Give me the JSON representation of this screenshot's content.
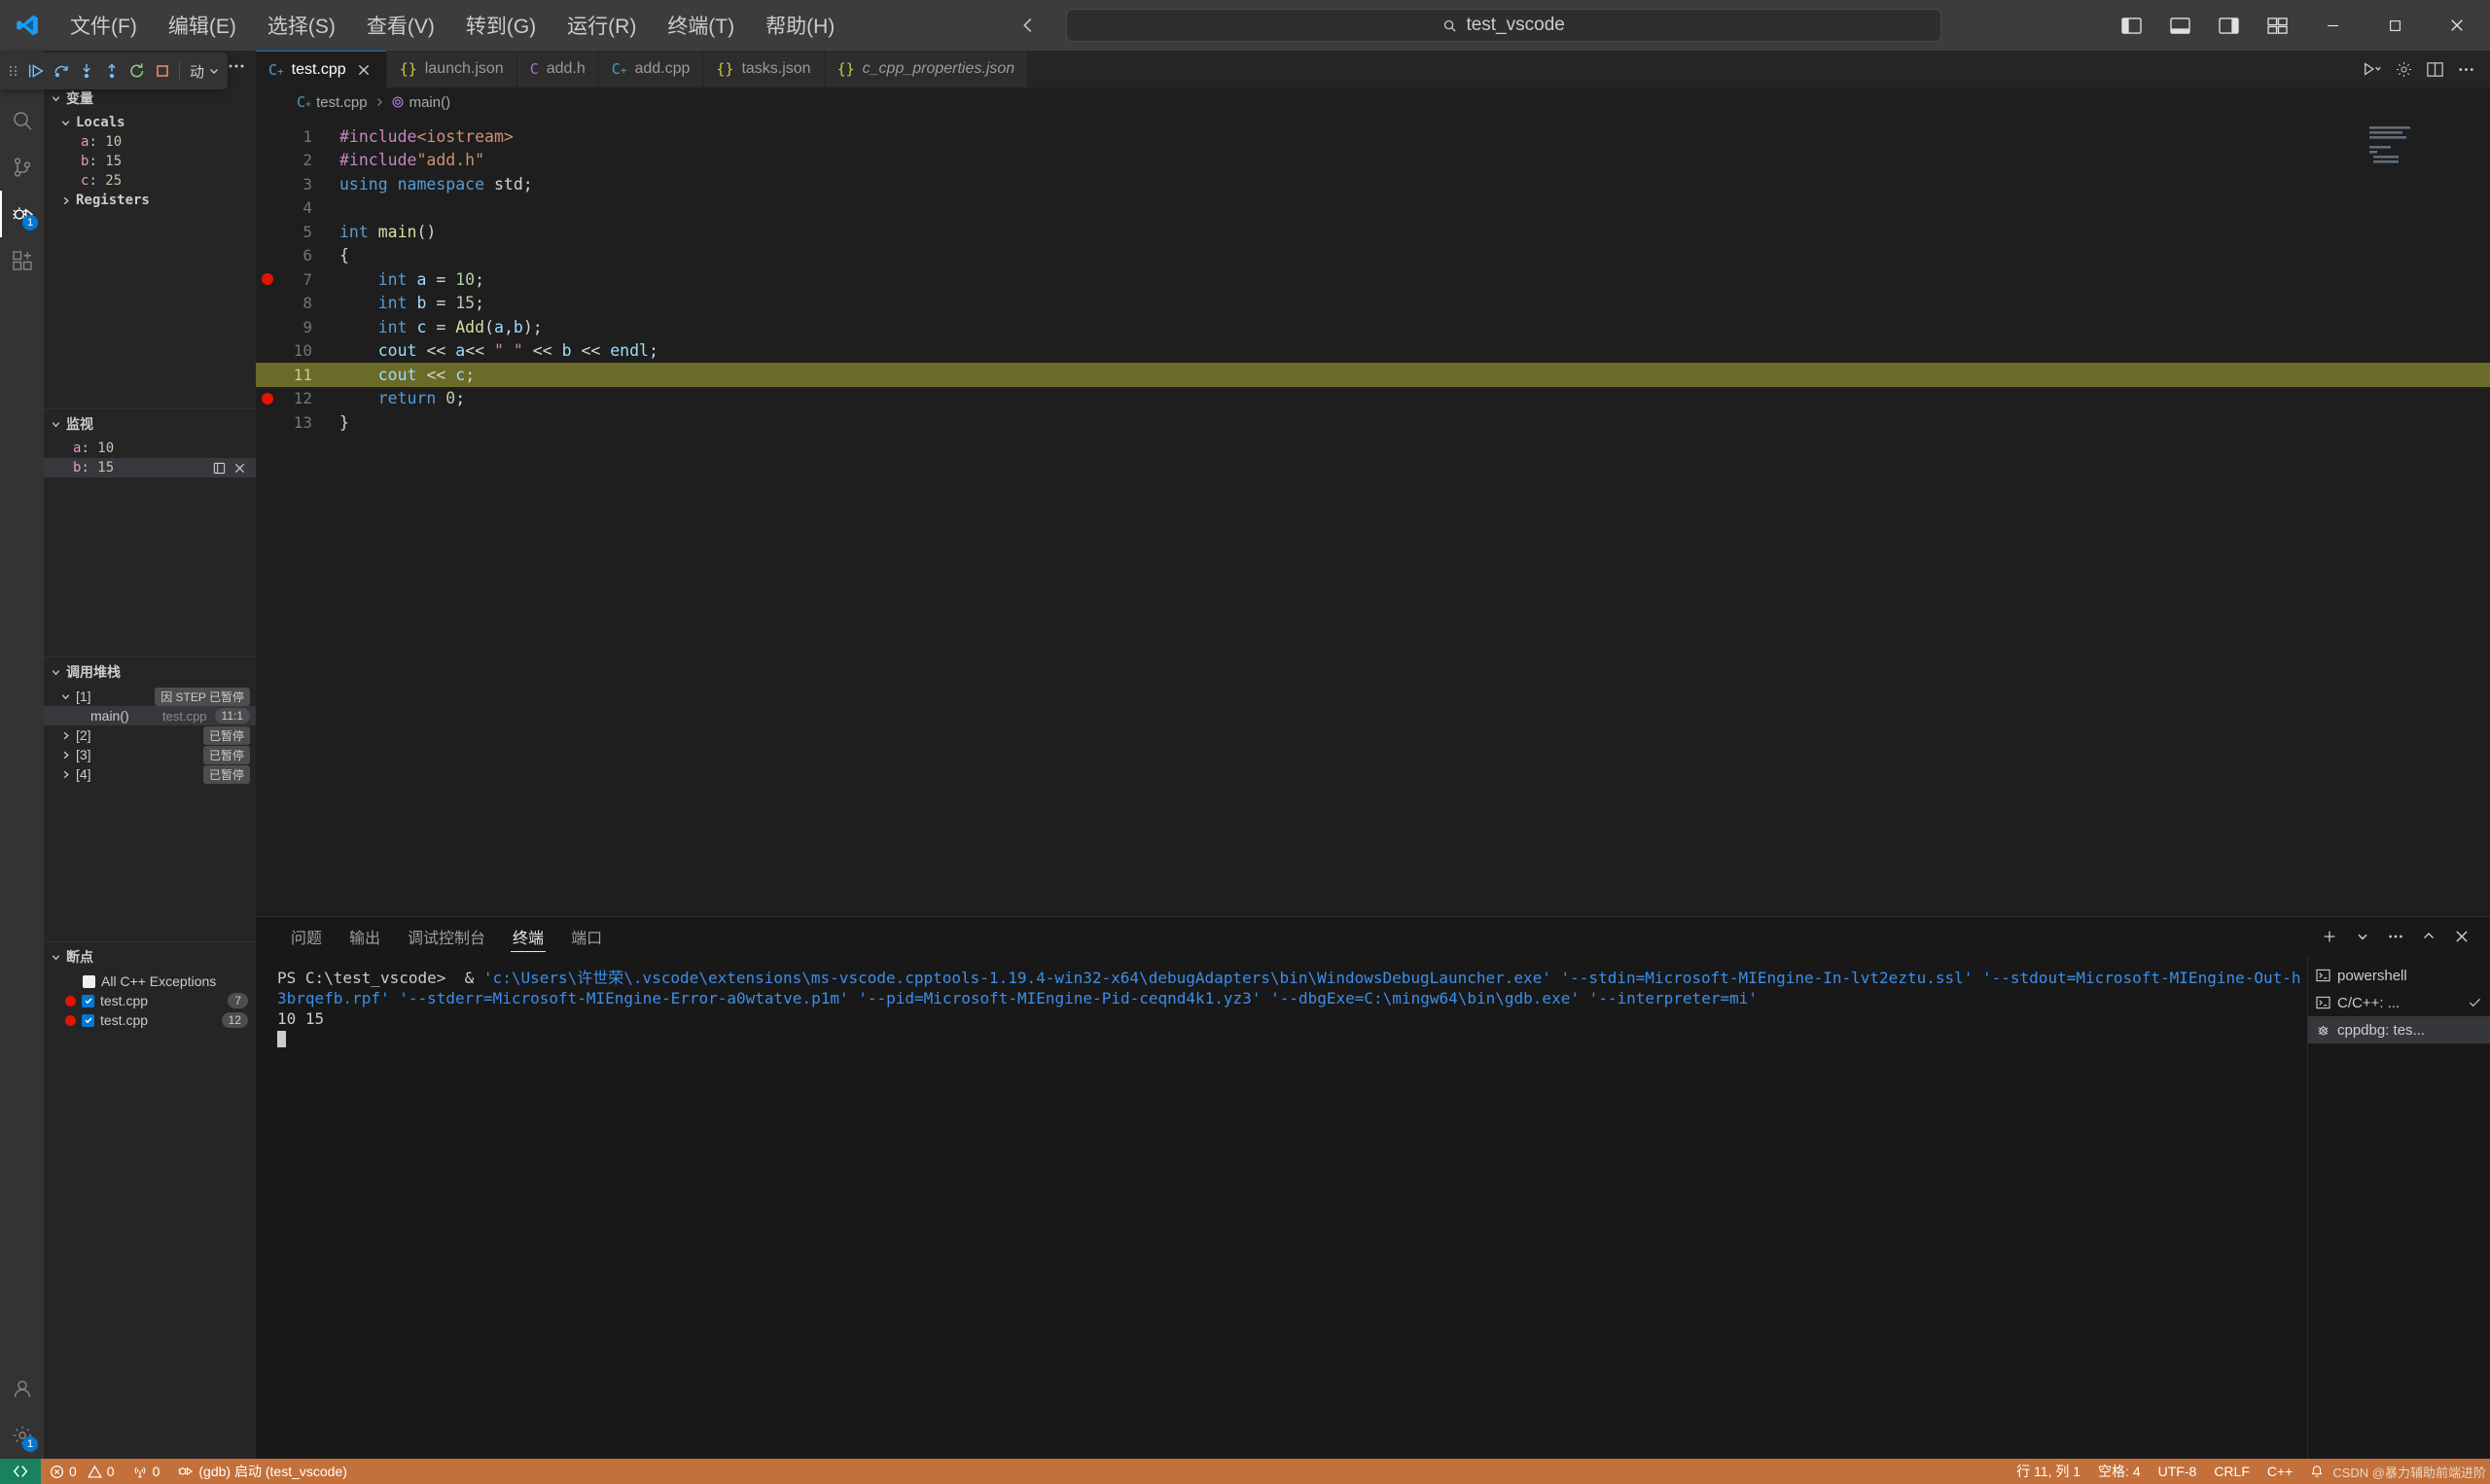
{
  "titlebar": {
    "menu": [
      "文件(F)",
      "编辑(E)",
      "选择(S)",
      "查看(V)",
      "转到(G)",
      "运行(R)",
      "终端(T)",
      "帮助(H)"
    ],
    "command_center_text": "test_vscode",
    "search_icon": "search-icon",
    "layout_icons": [
      "toggle-primary-sidebar-icon",
      "toggle-panel-icon",
      "toggle-secondary-sidebar-icon",
      "customize-layout-icon"
    ],
    "window_controls": [
      "minimize",
      "maximize",
      "close"
    ]
  },
  "debug_toolbar": {
    "buttons": [
      {
        "name": "continue",
        "icon": "continue-icon"
      },
      {
        "name": "step-over",
        "icon": "step-over-icon"
      },
      {
        "name": "step-into",
        "icon": "step-into-icon"
      },
      {
        "name": "step-out",
        "icon": "step-out-icon"
      },
      {
        "name": "restart",
        "icon": "restart-icon"
      },
      {
        "name": "stop",
        "icon": "stop-icon"
      }
    ],
    "session_label": "动",
    "gear_icon": "gear-icon",
    "more_icon": "more-icon"
  },
  "activitybar": {
    "items": [
      {
        "name": "explorer",
        "icon": "files-icon",
        "active": false,
        "badge": ""
      },
      {
        "name": "search",
        "icon": "search-icon",
        "active": false,
        "badge": ""
      },
      {
        "name": "source-control",
        "icon": "source-control-icon",
        "active": false,
        "badge": ""
      },
      {
        "name": "run-and-debug",
        "icon": "debug-icon",
        "active": true,
        "badge": "1"
      },
      {
        "name": "extensions",
        "icon": "extensions-icon",
        "active": false,
        "badge": ""
      }
    ],
    "bottom": [
      {
        "name": "accounts",
        "icon": "account-icon",
        "badge": ""
      },
      {
        "name": "settings",
        "icon": "gear-icon",
        "badge": "1"
      }
    ]
  },
  "sidebar": {
    "variables": {
      "title": "变量",
      "groups": [
        {
          "label": "Locals",
          "expanded": true,
          "items": [
            {
              "name": "a",
              "value": "10"
            },
            {
              "name": "b",
              "value": "15"
            },
            {
              "name": "c",
              "value": "25"
            }
          ]
        },
        {
          "label": "Registers",
          "expanded": false,
          "items": []
        }
      ]
    },
    "watch": {
      "title": "监视",
      "items": [
        {
          "name": "a",
          "value": "10",
          "selected": false
        },
        {
          "name": "b",
          "value": "15",
          "selected": true
        }
      ],
      "row_icons": [
        "edit-icon",
        "remove-icon"
      ]
    },
    "callstack": {
      "title": "调用堆栈",
      "threads": [
        {
          "label": "[1]",
          "expanded": true,
          "status": "因 STEP 已暂停",
          "frames": [
            {
              "label": "main()",
              "file": "test.cpp",
              "line": "11:1",
              "selected": true
            }
          ]
        },
        {
          "label": "[2]",
          "expanded": false,
          "status": "已暂停",
          "frames": []
        },
        {
          "label": "[3]",
          "expanded": false,
          "status": "已暂停",
          "frames": []
        },
        {
          "label": "[4]",
          "expanded": false,
          "status": "已暂停",
          "frames": []
        }
      ]
    },
    "breakpoints": {
      "title": "断点",
      "items": [
        {
          "label": "All C++ Exceptions",
          "checked": false,
          "has_dot": false,
          "line": ""
        },
        {
          "label": "test.cpp",
          "checked": true,
          "has_dot": true,
          "line": "7"
        },
        {
          "label": "test.cpp",
          "checked": true,
          "has_dot": true,
          "line": "12"
        }
      ]
    }
  },
  "editor": {
    "tabs": [
      {
        "label": "test.cpp",
        "icon": "cpp-file-icon",
        "icon_text": "C",
        "active": true,
        "closable": true
      },
      {
        "label": "launch.json",
        "icon": "json-file-icon",
        "icon_text": "{}",
        "active": false,
        "closable": false
      },
      {
        "label": "add.h",
        "icon": "c-header-icon",
        "icon_text": "C",
        "active": false,
        "closable": false
      },
      {
        "label": "add.cpp",
        "icon": "cpp-file-icon",
        "icon_text": "C",
        "active": false,
        "closable": false
      },
      {
        "label": "tasks.json",
        "icon": "json-file-icon",
        "icon_text": "{}",
        "active": false,
        "closable": false
      },
      {
        "label": "c_cpp_properties.json",
        "icon": "json-file-icon",
        "icon_text": "{}",
        "active": false,
        "closable": false,
        "italic": true
      }
    ],
    "tabbar_actions": [
      "run-or-debug-icon",
      "settings-icon",
      "split-editor-icon",
      "more-actions-icon"
    ],
    "breadcrumb": [
      "test.cpp",
      "main()"
    ],
    "lines": [
      {
        "n": "1",
        "bp": "none",
        "hl": false,
        "tokens": [
          {
            "t": "#include",
            "c": "t-pre"
          },
          {
            "t": "<iostream>",
            "c": "t-inc"
          }
        ]
      },
      {
        "n": "2",
        "bp": "none",
        "hl": false,
        "tokens": [
          {
            "t": "#include",
            "c": "t-pre"
          },
          {
            "t": "\"add.h\"",
            "c": "t-str"
          }
        ]
      },
      {
        "n": "3",
        "bp": "none",
        "hl": false,
        "tokens": [
          {
            "t": "using ",
            "c": "t-key"
          },
          {
            "t": "namespace ",
            "c": "t-key"
          },
          {
            "t": "std;",
            "c": "t-plain"
          }
        ]
      },
      {
        "n": "4",
        "bp": "none",
        "hl": false,
        "tokens": []
      },
      {
        "n": "5",
        "bp": "none",
        "hl": false,
        "tokens": [
          {
            "t": "int ",
            "c": "t-key"
          },
          {
            "t": "main",
            "c": "t-fn"
          },
          {
            "t": "()",
            "c": "t-plain"
          }
        ]
      },
      {
        "n": "6",
        "bp": "none",
        "hl": false,
        "tokens": [
          {
            "t": "{",
            "c": "t-plain"
          }
        ]
      },
      {
        "n": "7",
        "bp": "dot",
        "hl": false,
        "tokens": [
          {
            "t": "    ",
            "c": "t-plain"
          },
          {
            "t": "int ",
            "c": "t-key"
          },
          {
            "t": "a ",
            "c": "t-var"
          },
          {
            "t": "= ",
            "c": "t-op"
          },
          {
            "t": "10",
            "c": "t-num"
          },
          {
            "t": ";",
            "c": "t-plain"
          }
        ]
      },
      {
        "n": "8",
        "bp": "none",
        "hl": false,
        "tokens": [
          {
            "t": "    ",
            "c": "t-plain"
          },
          {
            "t": "int ",
            "c": "t-key"
          },
          {
            "t": "b ",
            "c": "t-var"
          },
          {
            "t": "= ",
            "c": "t-op"
          },
          {
            "t": "15",
            "c": "t-num"
          },
          {
            "t": ";",
            "c": "t-plain"
          }
        ]
      },
      {
        "n": "9",
        "bp": "none",
        "hl": false,
        "tokens": [
          {
            "t": "    ",
            "c": "t-plain"
          },
          {
            "t": "int ",
            "c": "t-key"
          },
          {
            "t": "c ",
            "c": "t-var"
          },
          {
            "t": "= ",
            "c": "t-op"
          },
          {
            "t": "Add",
            "c": "t-fn"
          },
          {
            "t": "(",
            "c": "t-plain"
          },
          {
            "t": "a",
            "c": "t-var"
          },
          {
            "t": ",",
            "c": "t-plain"
          },
          {
            "t": "b",
            "c": "t-var"
          },
          {
            "t": ");",
            "c": "t-plain"
          }
        ]
      },
      {
        "n": "10",
        "bp": "none",
        "hl": false,
        "tokens": [
          {
            "t": "    ",
            "c": "t-plain"
          },
          {
            "t": "cout ",
            "c": "t-var"
          },
          {
            "t": "<< ",
            "c": "t-op"
          },
          {
            "t": "a",
            "c": "t-var"
          },
          {
            "t": "<< ",
            "c": "t-op"
          },
          {
            "t": "\" \"",
            "c": "t-str"
          },
          {
            "t": " << ",
            "c": "t-op"
          },
          {
            "t": "b ",
            "c": "t-var"
          },
          {
            "t": "<< ",
            "c": "t-op"
          },
          {
            "t": "endl",
            "c": "t-var"
          },
          {
            "t": ";",
            "c": "t-plain"
          }
        ]
      },
      {
        "n": "11",
        "bp": "arrow",
        "hl": true,
        "tokens": [
          {
            "t": "    ",
            "c": "t-plain"
          },
          {
            "t": "cout ",
            "c": "t-var"
          },
          {
            "t": "<< ",
            "c": "t-op"
          },
          {
            "t": "c",
            "c": "t-var"
          },
          {
            "t": ";",
            "c": "t-plain"
          }
        ]
      },
      {
        "n": "12",
        "bp": "dot",
        "hl": false,
        "tokens": [
          {
            "t": "    ",
            "c": "t-plain"
          },
          {
            "t": "return ",
            "c": "t-key"
          },
          {
            "t": "0",
            "c": "t-num"
          },
          {
            "t": ";",
            "c": "t-plain"
          }
        ]
      },
      {
        "n": "13",
        "bp": "none",
        "hl": false,
        "tokens": [
          {
            "t": "}",
            "c": "t-plain"
          }
        ]
      }
    ]
  },
  "panel": {
    "tabs": [
      {
        "label": "问题",
        "active": false
      },
      {
        "label": "输出",
        "active": false
      },
      {
        "label": "调试控制台",
        "active": false
      },
      {
        "label": "终端",
        "active": true
      },
      {
        "label": "端口",
        "active": false
      }
    ],
    "actions": [
      "new-terminal-icon",
      "split-dropdown-icon",
      "more-actions-icon",
      "maximize-panel-icon",
      "close-panel-icon"
    ],
    "terminal_lines": [
      "PS C:\\test_vscode>  & 'c:\\Users\\许世荣\\.vscode\\extensions\\ms-vscode.cpptools-1.19.4-win32-x64\\debugAdapters\\bin\\WindowsDebugLauncher.exe' '--stdin=Microsoft-MIEngine-In-lvt2eztu.ssl' '--stdout=Microsoft-MIEngine-Out-h3brqefb.rpf' '--stderr=Microsoft-MIEngine-Error-a0wtatve.p1m' '--pid=Microsoft-MIEngine-Pid-ceqnd4k1.yz3' '--dbgExe=C:\\mingw64\\bin\\gdb.exe' '--interpreter=mi'",
      "10 15"
    ],
    "terminal_tabs": [
      {
        "label": "powershell",
        "icon": "terminal-icon",
        "selected": false,
        "check": false
      },
      {
        "label": "C/C++: ...",
        "icon": "terminal-icon",
        "selected": false,
        "check": true
      },
      {
        "label": "cppdbg: tes...",
        "icon": "debug-bug-icon",
        "selected": true,
        "check": false
      }
    ]
  },
  "statusbar": {
    "remote_icon": "remote-window-icon",
    "errors": "0",
    "warnings": "0",
    "ports": "0",
    "debug_config": "(gdb) 启动 (test_vscode)",
    "cursor_position": "行 11, 列 1",
    "indentation": "空格: 4",
    "encoding": "UTF-8",
    "eol": "CRLF",
    "language": "C++",
    "feedback_icon": "bell-icon",
    "watermark": "CSDN @暴力辅助前端进阶"
  }
}
